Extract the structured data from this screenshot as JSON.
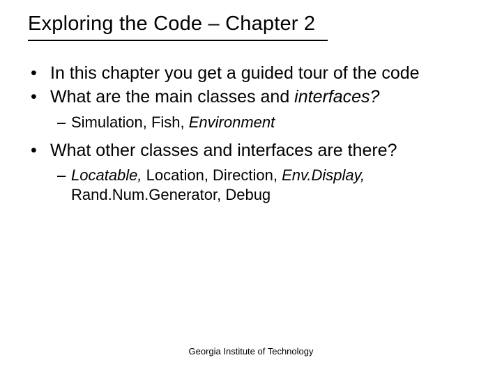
{
  "title": "Exploring the Code – Chapter 2",
  "bullets": {
    "b1": "In this chapter you get a guided tour of the code",
    "b2_pre": "What are the main classes and ",
    "b2_em": "interfaces?",
    "b2_sub_plain1": "Simulation, Fish, ",
    "b2_sub_em": "Environment",
    "b3": "What other classes and interfaces are there?",
    "b3_sub_em": "Locatable,",
    "b3_sub_plain1": " Location, Direction, ",
    "b3_sub_em2": "Env.Display,",
    "b3_sub_plain2": " Rand.Num.Generator, Debug"
  },
  "footer": "Georgia Institute of Technology"
}
